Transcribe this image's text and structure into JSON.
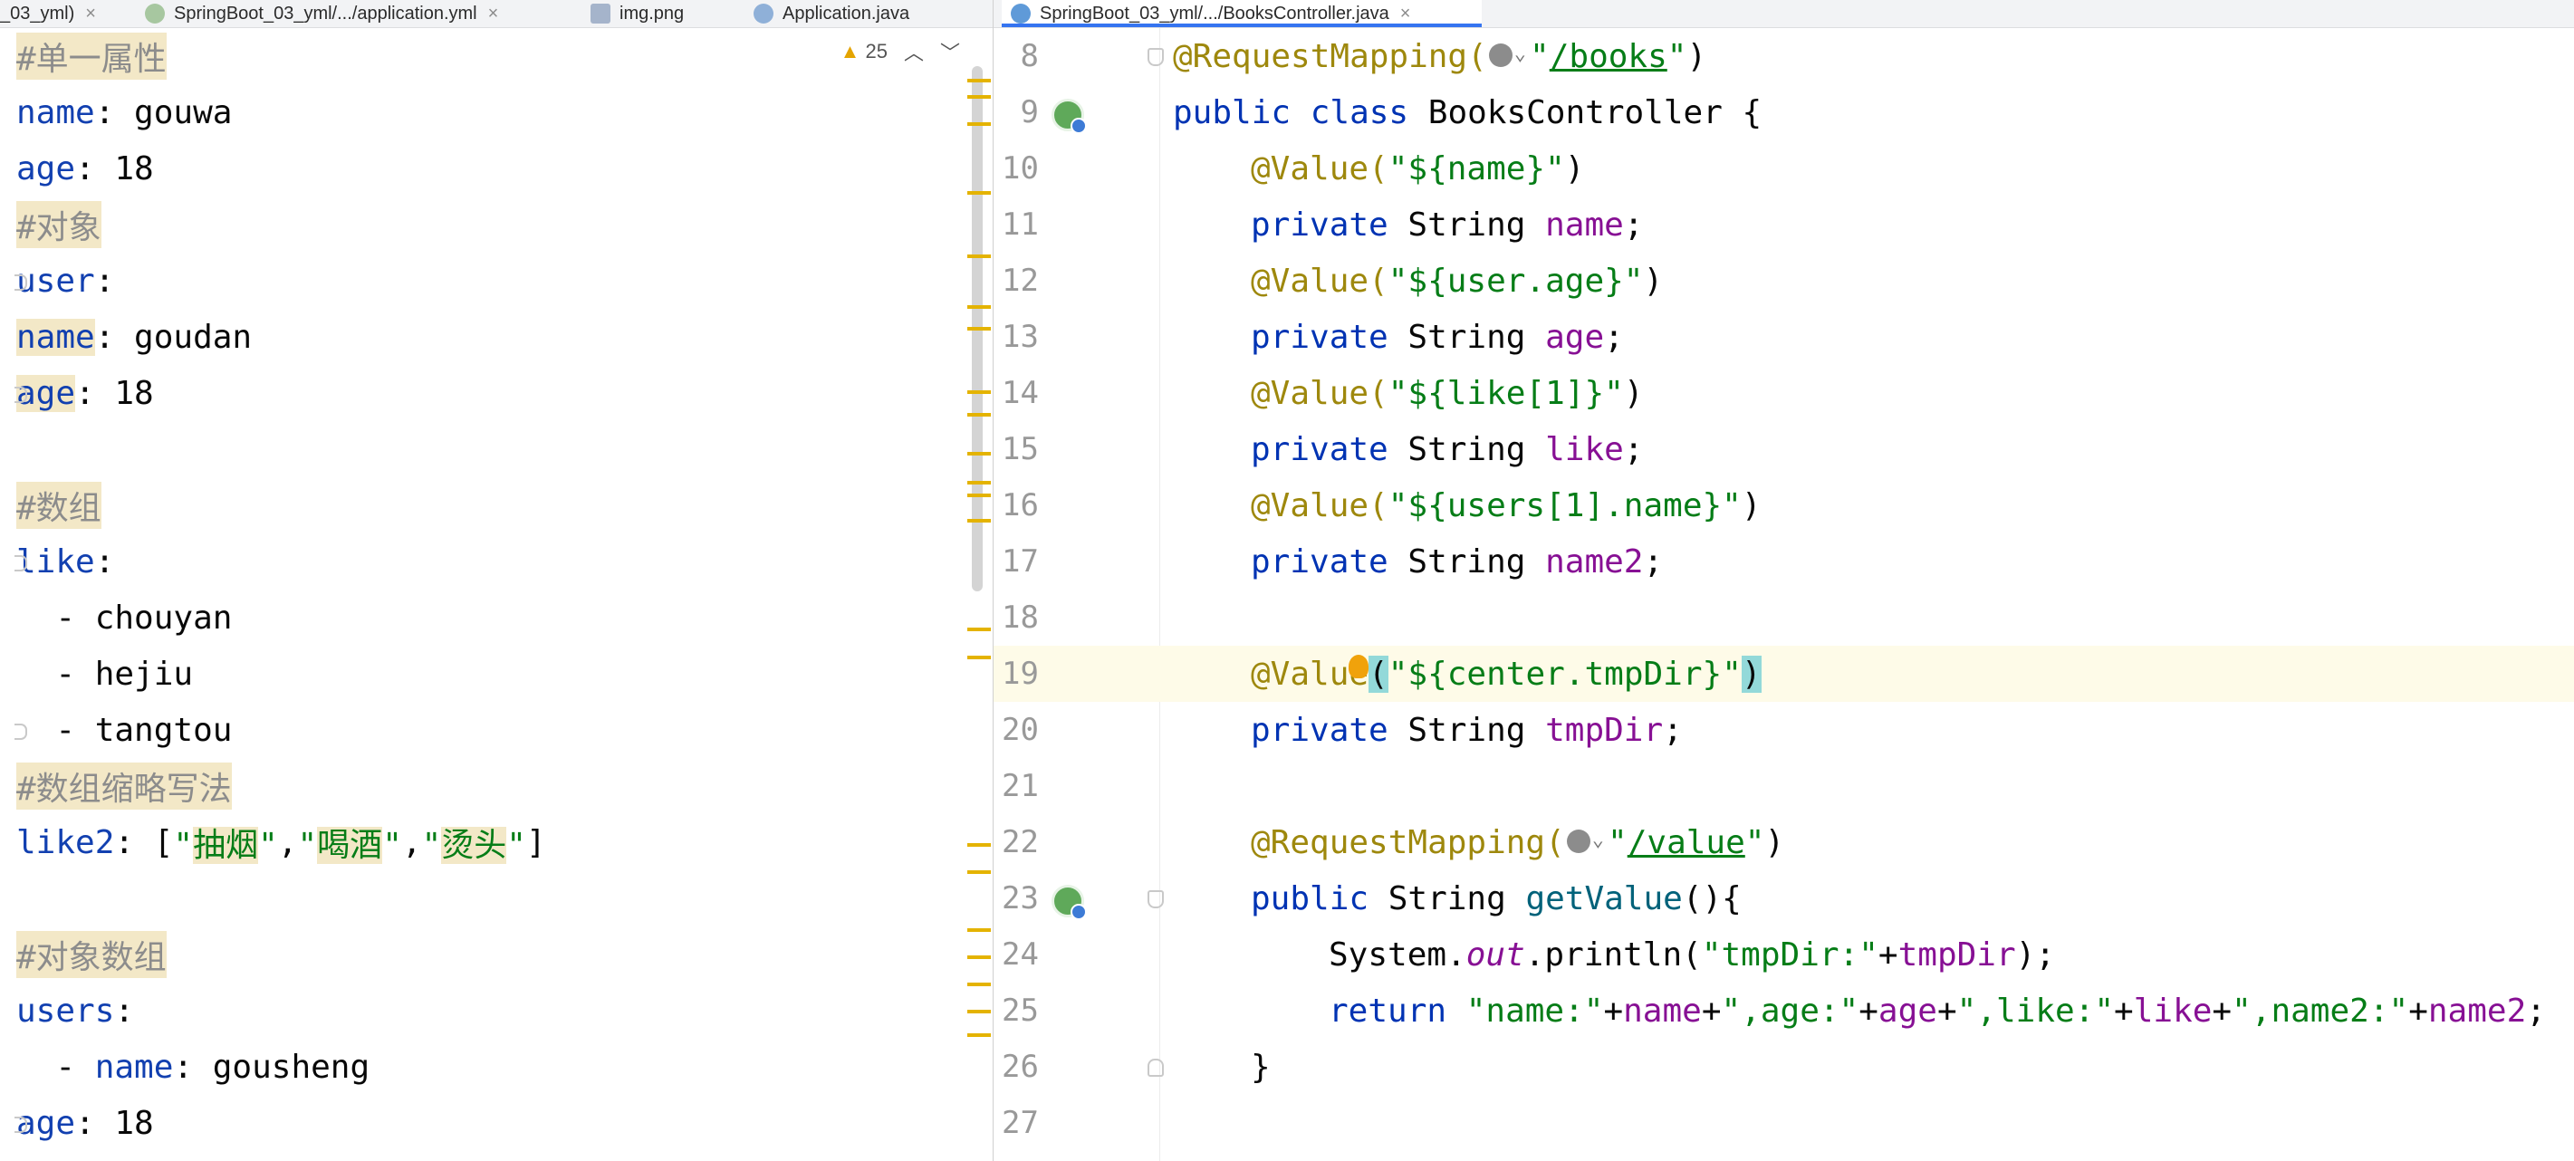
{
  "tabs": [
    {
      "label": "_03_yml)",
      "active": false
    },
    {
      "label": "SpringBoot_03_yml/.../application.yml",
      "active": false
    },
    {
      "label": "img.png",
      "active": false
    },
    {
      "label": "Application.java",
      "active": false
    },
    {
      "label": "SpringBoot_03_yml/.../BooksController.java",
      "active": true
    }
  ],
  "tab_close_glyph": "×",
  "left_editor": {
    "inspection_count": "25",
    "lines": [
      "#单一属性",
      "name: gouwa",
      "age: 18",
      "#对象",
      "user:",
      "  name: goudan",
      "  age: 18",
      "",
      "#数组",
      "like:",
      "  - chouyan",
      "  - hejiu",
      "  - tangtou",
      "#数组缩略写法",
      "like2: [\"抽烟\",\"喝酒\",\"烫头\"]",
      "",
      "#对象数组",
      "users:",
      "  - name: gousheng",
      "    age: 18"
    ]
  },
  "right_editor": {
    "line_numbers": [
      "8",
      "9",
      "10",
      "11",
      "12",
      "13",
      "14",
      "15",
      "16",
      "17",
      "18",
      "19",
      "20",
      "21",
      "22",
      "23",
      "24",
      "25",
      "26",
      "27"
    ],
    "current_line": "19",
    "code": {
      "l8_ann": "@RequestMapping(",
      "l8_str_open": "\"",
      "l8_url": "/books",
      "l8_str_close": "\"",
      "l8_end": ")",
      "l9_kw": "public class ",
      "l9_name": "BooksController {",
      "l10_ann": "@Value(",
      "l10_str": "\"${name}\"",
      "l10_end": ")",
      "l11_kw": "private ",
      "l11_type": "String ",
      "l11_fld": "name",
      "l11_end": ";",
      "l12_ann": "@Value(",
      "l12_str": "\"${user.age}\"",
      "l12_end": ")",
      "l13_kw": "private ",
      "l13_type": "String ",
      "l13_fld": "age",
      "l13_end": ";",
      "l14_ann": "@Value(",
      "l14_str": "\"${like[1]}\"",
      "l14_end": ")",
      "l15_kw": "private ",
      "l15_type": "String ",
      "l15_fld": "like",
      "l15_end": ";",
      "l16_ann": "@Value(",
      "l16_str": "\"${users[1].name}\"",
      "l16_end": ")",
      "l17_kw": "private ",
      "l17_type": "String ",
      "l17_fld": "name2",
      "l17_end": ";",
      "l19_ann": "@Value",
      "l19_paren": "(",
      "l19_str": "\"${center.tmpDir}\"",
      "l19_end": ")",
      "l20_kw": "private ",
      "l20_type": "String ",
      "l20_fld": "tmpDir",
      "l20_end": ";",
      "l22_ann": "@RequestMapping(",
      "l22_str_open": "\"",
      "l22_url": "/value",
      "l22_str_close": "\"",
      "l22_end": ")",
      "l23_kw": "public ",
      "l23_type": "String ",
      "l23_mth": "getValue",
      "l23_end": "(){",
      "l24_a": "System.",
      "l24_out": "out",
      "l24_b": ".println(",
      "l24_s": "\"tmpDir:\"",
      "l24_plus": "+",
      "l24_fld": "tmpDir",
      "l24_end": ");",
      "l25_kw": "return ",
      "l25_s1": "\"name:\"",
      "l25_p1": "+",
      "l25_f1": "name",
      "l25_p2": "+",
      "l25_s2": "\",age:\"",
      "l25_p3": "+",
      "l25_f2": "age",
      "l25_p4": "+",
      "l25_s3": "\",like:\"",
      "l25_p5": "+",
      "l25_f3": "like",
      "l25_p6": "+",
      "l25_s4": "\",name2:\"",
      "l25_p7": "+",
      "l25_f4": "name2",
      "l25_end": ";",
      "l26": "}"
    }
  },
  "colors": {
    "keyword": "#0033b3",
    "annotation": "#9e880d",
    "string": "#067d17",
    "field": "#871094",
    "yaml_key": "#1240b0",
    "comment": "#8c8c8c",
    "current_line": "#fefbe8",
    "active_tab_underline": "#3574f0"
  },
  "icons": [
    "close-icon",
    "yaml-file-icon",
    "image-file-icon",
    "java-class-icon",
    "warning-icon",
    "chevron-up-icon",
    "chevron-down-icon",
    "spring-bean-gutter-icon",
    "globe-icon",
    "bulb-icon"
  ]
}
